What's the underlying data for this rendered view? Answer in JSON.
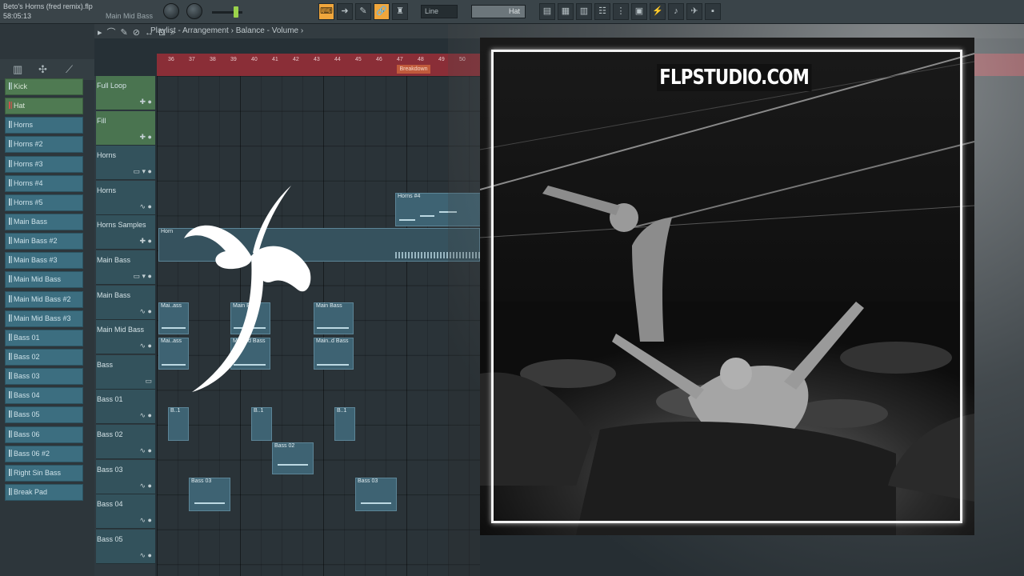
{
  "toolbar": {
    "project_title": "Beto's Horns (fred remix).flp",
    "song_time": "58:05:13",
    "hint": "Main Mid Bass",
    "snap_mode": "Line",
    "selected_channel": "Hat",
    "accent_color": "#f0a63c"
  },
  "playlist": {
    "breadcrumb": "Playlist - Arrangement › Balance - Volume ›",
    "ruler_bars": [
      "36",
      "37",
      "38",
      "39",
      "40",
      "41",
      "42",
      "43",
      "44",
      "45",
      "46",
      "47",
      "48",
      "49",
      "50"
    ],
    "marker": "Breakdown",
    "tracks": [
      {
        "name": "Full Loop",
        "style": "green",
        "ctl": "✚ ●"
      },
      {
        "name": "Fill",
        "style": "green",
        "ctl": "✚ ●"
      },
      {
        "name": "Horns",
        "style": "teal",
        "ctl": "▭ ▾ ●"
      },
      {
        "name": "Horns",
        "style": "teal",
        "ctl": "∿ ●"
      },
      {
        "name": "Horns Samples",
        "style": "teal",
        "ctl": "✚ ●"
      },
      {
        "name": "Main Bass",
        "style": "teal",
        "ctl": "▭ ▾ ●"
      },
      {
        "name": "Main Bass",
        "style": "teal",
        "ctl": "∿ ●"
      },
      {
        "name": "Main Mid Bass",
        "style": "teal",
        "ctl": "∿ ●"
      },
      {
        "name": "Bass",
        "style": "teal",
        "ctl": "▭"
      },
      {
        "name": "Bass 01",
        "style": "teal",
        "ctl": "∿ ●"
      },
      {
        "name": "Bass 02",
        "style": "teal",
        "ctl": "∿ ●"
      },
      {
        "name": "Bass 03",
        "style": "teal",
        "ctl": "∿ ●"
      },
      {
        "name": "Bass 04",
        "style": "teal",
        "ctl": "∿ ●"
      },
      {
        "name": "Bass 05",
        "style": "teal",
        "ctl": "∿ ●"
      }
    ],
    "clips": {
      "horns_4": "Horns #4",
      "horns_samples": "Horn",
      "main_bass_1": "Mai..ass",
      "main_bass_2": "Main Bass",
      "main_bass_3": "Main Bass",
      "mid_bass_1": "Mai..ass",
      "mid_bass_2": "Main..d Bass",
      "mid_bass_3": "Main..d Bass",
      "bass01_1": "B..1",
      "bass01_2": "B..1",
      "bass01_3": "B..1",
      "bass02_1": "Bass 02",
      "bass03_1": "Bass 03",
      "bass03_2": "Bass 03"
    }
  },
  "channels": [
    {
      "label": "Kick",
      "style": "green"
    },
    {
      "label": "Hat",
      "style": "green",
      "selected": true
    },
    {
      "label": "Horns",
      "style": "teal"
    },
    {
      "label": "Horns #2",
      "style": "teal"
    },
    {
      "label": "Horns #3",
      "style": "teal"
    },
    {
      "label": "Horns #4",
      "style": "teal"
    },
    {
      "label": "Horns #5",
      "style": "teal"
    },
    {
      "label": "Main Bass",
      "style": "teal"
    },
    {
      "label": "Main Bass #2",
      "style": "teal"
    },
    {
      "label": "Main Bass #3",
      "style": "teal"
    },
    {
      "label": "Main Mid Bass",
      "style": "teal"
    },
    {
      "label": "Main Mid Bass #2",
      "style": "teal"
    },
    {
      "label": "Main Mid Bass #3",
      "style": "teal"
    },
    {
      "label": "Bass 01",
      "style": "teal"
    },
    {
      "label": "Bass 02",
      "style": "teal"
    },
    {
      "label": "Bass 03",
      "style": "teal"
    },
    {
      "label": "Bass 04",
      "style": "teal"
    },
    {
      "label": "Bass 05",
      "style": "teal"
    },
    {
      "label": "Bass 06",
      "style": "teal"
    },
    {
      "label": "Bass 06 #2",
      "style": "teal"
    },
    {
      "label": "Right Sin Bass",
      "style": "teal"
    },
    {
      "label": "Break Pad",
      "style": "teal"
    }
  ],
  "overlay": {
    "watermark": "FLPSTUDIO.COM"
  }
}
